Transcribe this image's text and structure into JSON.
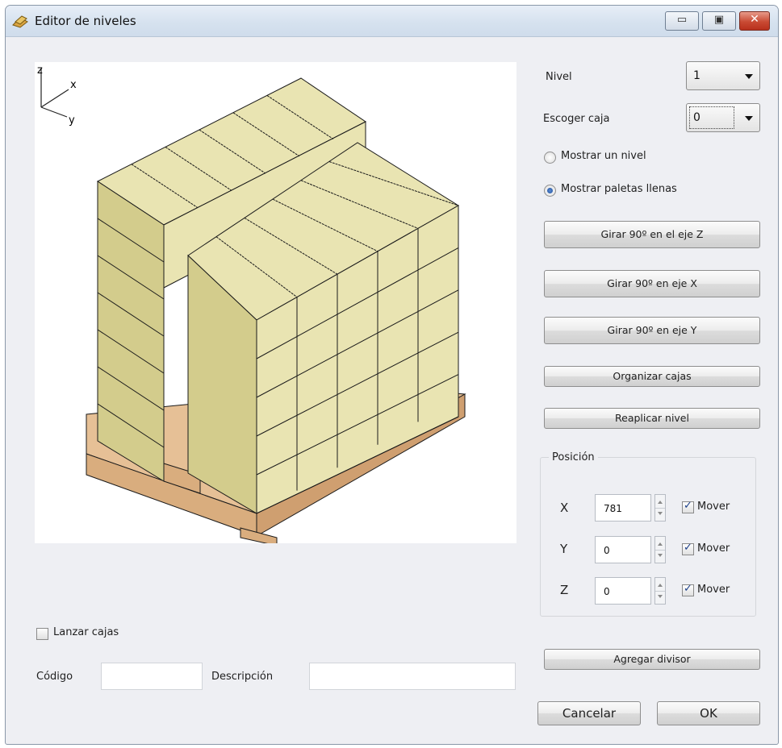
{
  "window": {
    "title": "Editor de niveles",
    "controls": {
      "minimize": "▭",
      "maximize": "▣",
      "close": "✕"
    }
  },
  "viewport": {
    "axes": {
      "z": "z",
      "x": "x",
      "y": "y"
    },
    "colors": {
      "box_face": "#e9e4b2",
      "box_side": "#d3cc8c",
      "box_outline": "#1a1a1a",
      "pallet": "#e6c096"
    }
  },
  "controls": {
    "nivel_label": "Nivel",
    "nivel_value": "1",
    "escoger_caja_label": "Escoger caja",
    "escoger_caja_value": "0",
    "radio_un_nivel": "Mostrar un nivel",
    "radio_paletas": "Mostrar paletas llenas",
    "selected_view": "Mostrar paletas llenas",
    "buttons": {
      "girar_z": "Girar 90º en el eje Z",
      "girar_x": "Girar 90º en eje X",
      "girar_y": "Girar 90º en eje Y",
      "organizar": "Organizar cajas",
      "reaplicar": "Reaplicar nivel",
      "agregar": "Agregar divisor",
      "cancelar": "Cancelar",
      "ok": "OK"
    }
  },
  "position": {
    "title": "Posición",
    "rows": [
      {
        "axis": "X",
        "value": "781",
        "mover_label": "Mover",
        "mover": true
      },
      {
        "axis": "Y",
        "value": "0",
        "mover_label": "Mover",
        "mover": true
      },
      {
        "axis": "Z",
        "value": "0",
        "mover_label": "Mover",
        "mover": true
      }
    ]
  },
  "bottom": {
    "lanzar_label": "Lanzar cajas",
    "lanzar_checked": false,
    "codigo_label": "Código",
    "codigo_value": "",
    "descripcion_label": "Descripción",
    "descripcion_value": ""
  }
}
